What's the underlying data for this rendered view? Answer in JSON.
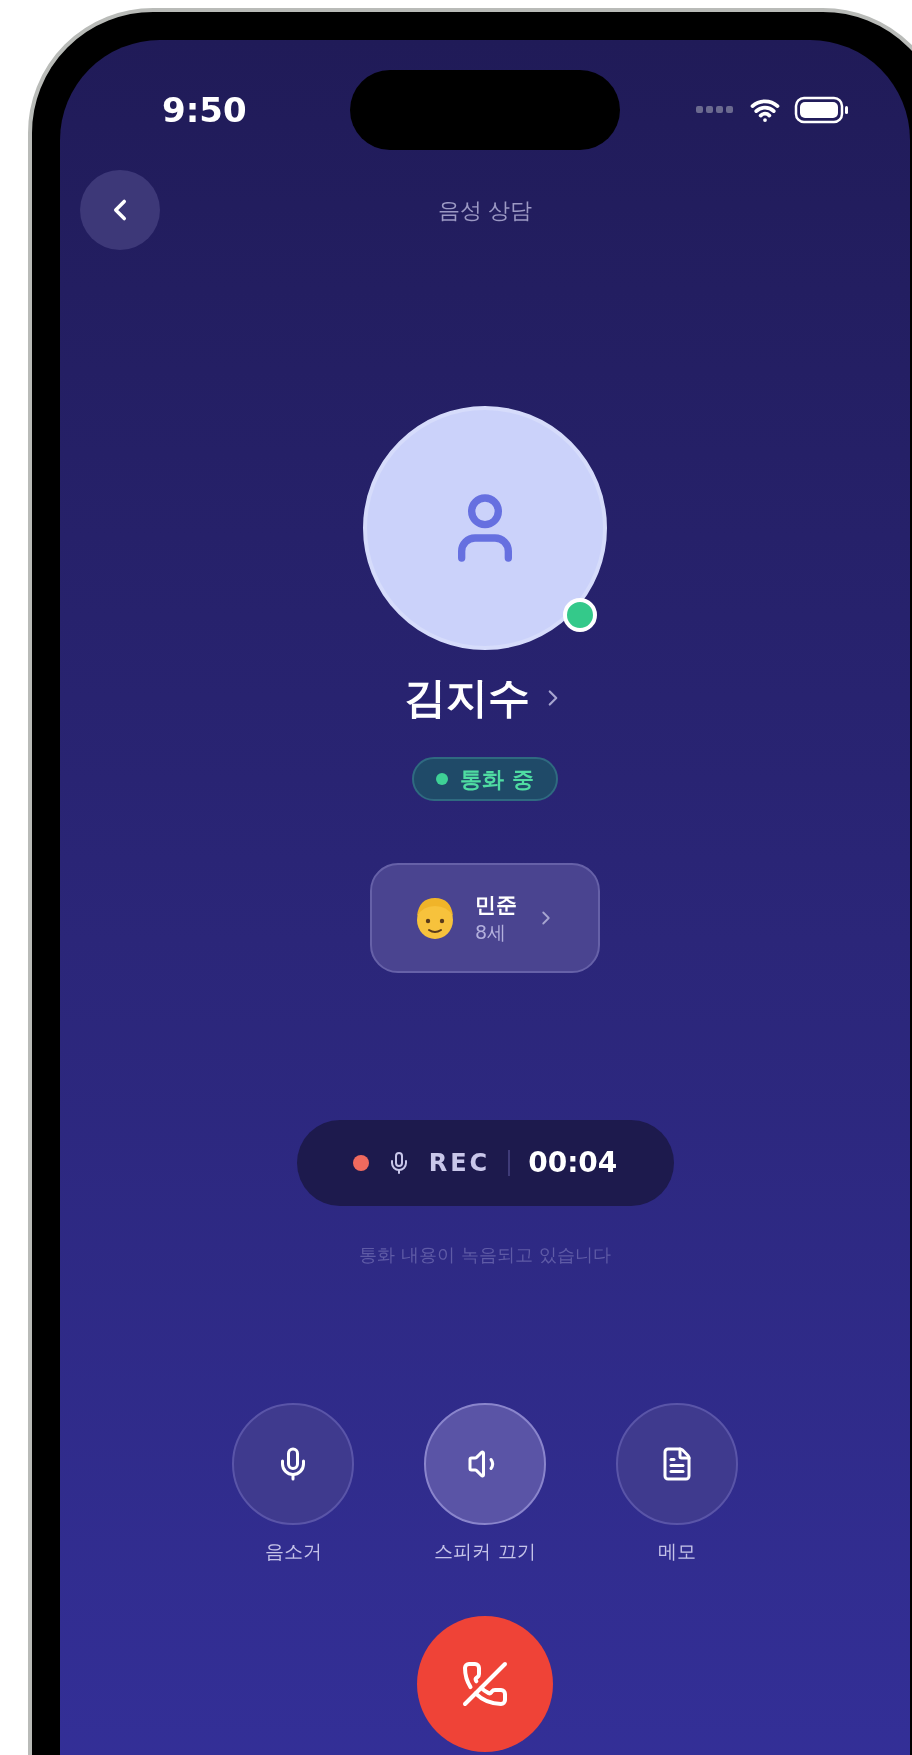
{
  "status_bar": {
    "time": "9:50"
  },
  "header": {
    "title": "음성 상담"
  },
  "contact": {
    "name": "김지수",
    "online": true,
    "status": {
      "label": "통화 중"
    }
  },
  "child": {
    "name": "민준",
    "age": "8세"
  },
  "recording": {
    "recording": true,
    "label": "REC",
    "elapsed": "00:04",
    "note": "통화 내용이 녹음되고 있습니다"
  },
  "controls": [
    {
      "kind": "mic",
      "label": "음소거",
      "selected": false
    },
    {
      "kind": "speaker",
      "label": "스피커 끄기",
      "selected": true
    },
    {
      "kind": "memo",
      "label": "메모",
      "selected": false
    }
  ]
}
